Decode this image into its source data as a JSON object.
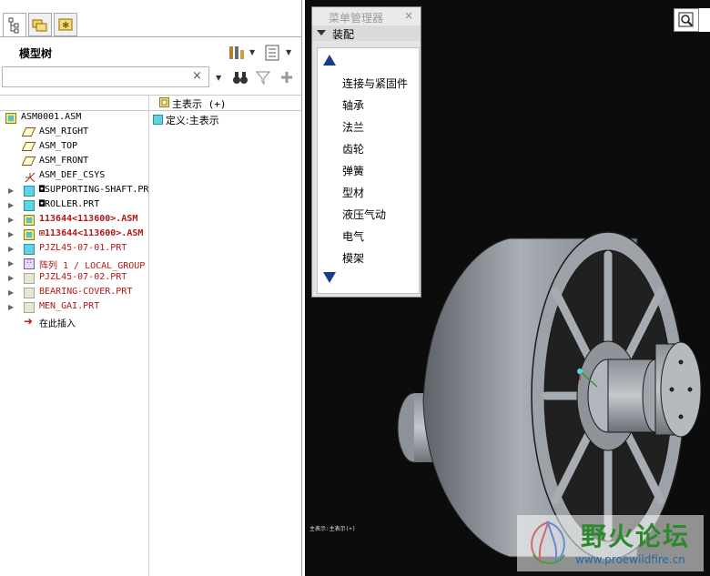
{
  "left_panel": {
    "tabs": [
      {
        "name": "model-tree-tab",
        "icon": "model-tree-icon"
      },
      {
        "name": "folder-browser-tab",
        "icon": "folder-icon"
      },
      {
        "name": "favorites-tab",
        "icon": "star-folder-icon"
      }
    ],
    "title": "模型树",
    "toolbar": {
      "settings_icon": "tree-settings-icon",
      "columns_icon": "tree-columns-icon",
      "find_icon": "binoculars-icon",
      "filter_icon": "filter-icon",
      "add_icon": "plus-icon"
    },
    "search": {
      "value": "",
      "clear_glyph": "×"
    },
    "column2_title": "主表示 (+)",
    "column2_value": "定义:主表示",
    "tree": [
      {
        "label": "ASM0001.ASM",
        "icon": "asm",
        "indent": 0,
        "expander": "",
        "style": ""
      },
      {
        "label": "ASM_RIGHT",
        "icon": "plane",
        "indent": 1,
        "expander": "",
        "style": ""
      },
      {
        "label": "ASM_TOP",
        "icon": "plane",
        "indent": 1,
        "expander": "",
        "style": ""
      },
      {
        "label": "ASM_FRONT",
        "icon": "plane",
        "indent": 1,
        "expander": "",
        "style": ""
      },
      {
        "label": "ASM_DEF_CSYS",
        "icon": "csys",
        "indent": 1,
        "expander": "",
        "style": ""
      },
      {
        "label": "◘SUPPORTING-SHAFT.PRT",
        "icon": "prt",
        "indent": 1,
        "expander": "▶",
        "style": ""
      },
      {
        "label": "◘ROLLER.PRT",
        "icon": "prt",
        "indent": 1,
        "expander": "▶",
        "style": ""
      },
      {
        "label": "113644<113600>.ASM",
        "icon": "asm",
        "indent": 1,
        "expander": "▶",
        "style": "red bold"
      },
      {
        "label": "⊠113644<113600>.ASM",
        "icon": "asm",
        "indent": 1,
        "expander": "▶",
        "style": "red bold"
      },
      {
        "label": "PJZL45-07-01.PRT",
        "icon": "prt",
        "indent": 1,
        "expander": "▶",
        "style": "red"
      },
      {
        "label": "阵列 1 / LOCAL_GROUP",
        "icon": "group",
        "indent": 1,
        "expander": "▶",
        "style": "red"
      },
      {
        "label": "PJZL45-07-02.PRT",
        "icon": "prt-gray",
        "indent": 1,
        "expander": "▶",
        "style": "red"
      },
      {
        "label": "BEARING-COVER.PRT",
        "icon": "prt-gray",
        "indent": 1,
        "expander": "▶",
        "style": "red"
      },
      {
        "label": "MEN_GAI.PRT",
        "icon": "prt-gray",
        "indent": 1,
        "expander": "▶",
        "style": "red"
      },
      {
        "label": "在此插入",
        "icon": "insert-arrow",
        "indent": 1,
        "expander": "",
        "style": ""
      }
    ]
  },
  "menu_manager": {
    "title": "菜单管理器",
    "close_glyph": "×",
    "section": "装配",
    "items": [
      "连接与紧固件",
      "轴承",
      "法兰",
      "齿轮",
      "弹簧",
      "型材",
      "液压气动",
      "电气",
      "模架"
    ]
  },
  "viewport": {
    "zoom_icon": "zoom-search-icon",
    "status_text": "主表示:主表示(+)"
  },
  "watermark": {
    "title": "野火论坛",
    "url": "www.proewildfire.cn"
  },
  "colors": {
    "viewport_bg": "#0c0c0c",
    "part_gray": "#9aa0a6",
    "menu_arrow": "#1a3c8c",
    "tree_red": "#b01818"
  }
}
